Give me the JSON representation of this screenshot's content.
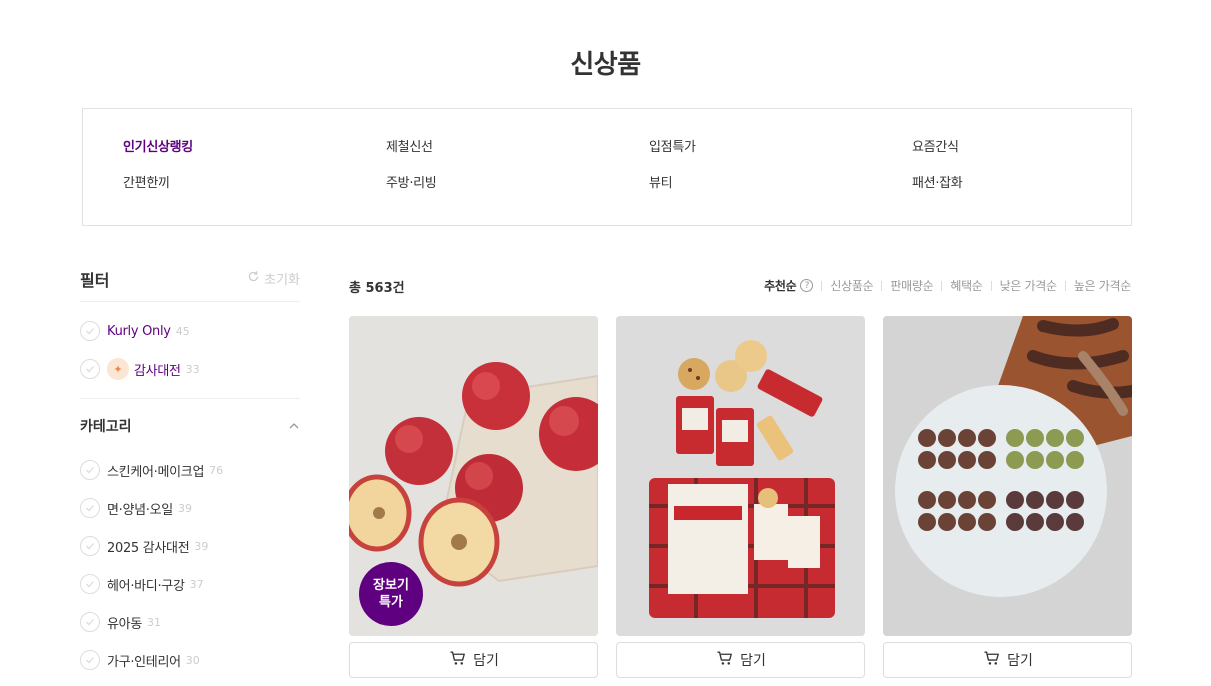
{
  "page": {
    "title": "신상품"
  },
  "categories": [
    {
      "label": "인기신상랭킹",
      "active": true
    },
    {
      "label": "제철신선",
      "active": false
    },
    {
      "label": "입점특가",
      "active": false
    },
    {
      "label": "요즘간식",
      "active": false
    },
    {
      "label": "간편한끼",
      "active": false
    },
    {
      "label": "주방·리빙",
      "active": false
    },
    {
      "label": "뷰티",
      "active": false
    },
    {
      "label": "패션·잡화",
      "active": false
    }
  ],
  "filter": {
    "title": "필터",
    "reset_label": "초기화",
    "quick": [
      {
        "label": "Kurly Only",
        "count": "45"
      },
      {
        "label": "감사대전",
        "count": "33"
      }
    ],
    "category_title": "카테고리",
    "category_items": [
      {
        "label": "스킨케어·메이크업",
        "count": "76"
      },
      {
        "label": "면·양념·오일",
        "count": "39"
      },
      {
        "label": "2025 감사대전",
        "count": "39"
      },
      {
        "label": "헤어·바디·구강",
        "count": "37"
      },
      {
        "label": "유아동",
        "count": "31"
      },
      {
        "label": "가구·인테리어",
        "count": "30"
      }
    ]
  },
  "list": {
    "total_label": "총 563건",
    "sort_options": [
      {
        "label": "추천순",
        "active": true
      },
      {
        "label": "신상품순",
        "active": false
      },
      {
        "label": "판매량순",
        "active": false
      },
      {
        "label": "혜택순",
        "active": false
      },
      {
        "label": "낮은 가격순",
        "active": false
      },
      {
        "label": "높은 가격순",
        "active": false
      }
    ],
    "help_icon": "question-circle-icon"
  },
  "products": [
    {
      "image": "apples",
      "badge_line1": "장보기",
      "badge_line2": "특가",
      "cart_label": "담기"
    },
    {
      "image": "walkers-shortbread",
      "cart_label": "담기"
    },
    {
      "image": "sausage-platter",
      "cart_label": "담기"
    }
  ],
  "colors": {
    "accent": "#5f0080",
    "border": "#e2e2e2"
  }
}
